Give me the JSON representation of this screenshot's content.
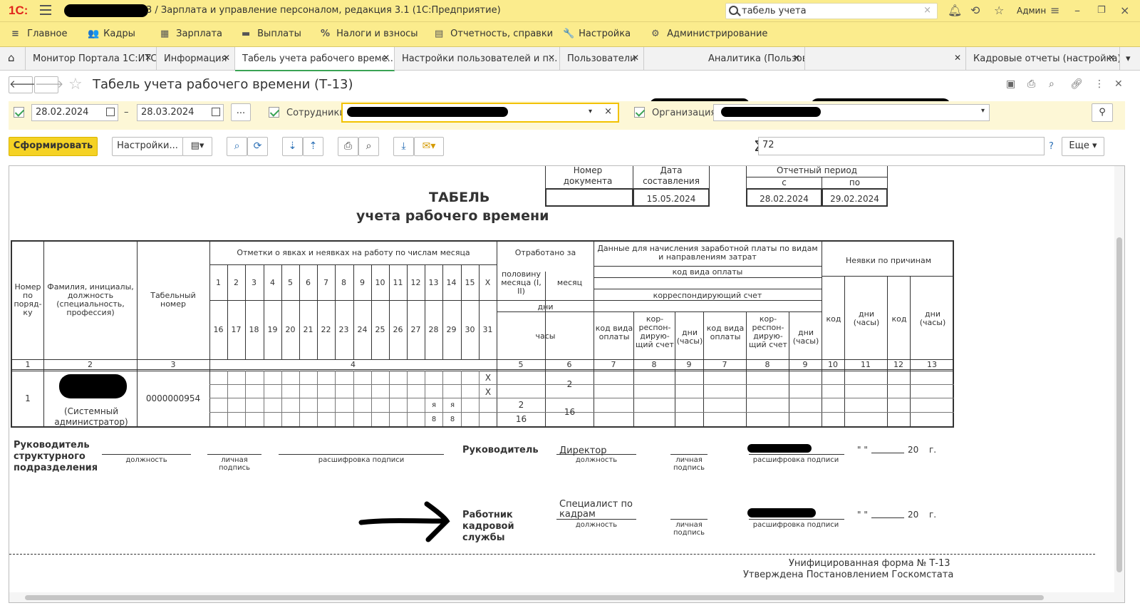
{
  "app": {
    "logo": "1С:",
    "title": "3 / Зарплата и управление персоналом, редакция 3.1  (1С:Предприятие)",
    "search_value": "табель учета",
    "user": "Админ"
  },
  "menu": [
    {
      "icon": "≡",
      "label": "Главное"
    },
    {
      "icon": "👥",
      "label": "Кадры"
    },
    {
      "icon": "▦",
      "label": "Зарплата"
    },
    {
      "icon": "▬",
      "label": "Выплаты"
    },
    {
      "icon": "%",
      "label": "Налоги и взносы"
    },
    {
      "icon": "▤",
      "label": "Отчетность, справки"
    },
    {
      "icon": "🔧",
      "label": "Настройка"
    },
    {
      "icon": "⚙",
      "label": "Администрирование"
    }
  ],
  "tabs": [
    {
      "label": "Монитор Портала 1С:ИТС"
    },
    {
      "label": "Информация"
    },
    {
      "label": "Табель учета рабочего време..."
    },
    {
      "label": "Настройки пользователей и п..."
    },
    {
      "label": "Пользователи"
    },
    {
      "label": "Аналитика (Пользова..."
    },
    {
      "label": ""
    },
    {
      "label": "Кадровые отчеты (настройка)"
    }
  ],
  "form": {
    "title": "Табель учета рабочего времени (Т-13)",
    "date_from": "28.02.2024",
    "date_sep": "–",
    "date_to": "28.03.2024",
    "dots": "...",
    "employees_label": "Сотрудники:",
    "org_label": "Организация:",
    "generate": "Сформировать",
    "settings": "Настройки...",
    "sum_value": "72",
    "help": "?",
    "more": "Еще"
  },
  "report": {
    "doc_num_header": "Номер документа",
    "doc_date_header": "Дата составления",
    "doc_date": "15.05.2024",
    "period_header": "Отчетный период",
    "period_from_label": "с",
    "period_to_label": "по",
    "period_from": "28.02.2024",
    "period_to": "29.02.2024",
    "title1": "ТАБЕЛЬ",
    "title2": "учета  рабочего времени",
    "h_num": "Номер по поряд-ку",
    "h_name": "Фамилия, инициалы, должность (специальность, профессия)",
    "h_tab": "Табельный номер",
    "h_marks": "Отметки о явках и неявках на работу по числам месяца",
    "h_worked": "Отработано за",
    "h_half": "половину месяца (I, II)",
    "h_month": "месяц",
    "h_days": "дни",
    "h_hours": "часы",
    "h_pay": "Данные для начисления заработной платы по видам и направлениям затрат",
    "h_paycode": "код вида оплаты",
    "h_corr": "корреспондирующий счет",
    "h_sub_code": "код вида оплаты",
    "h_sub_corr": "кор-респон-дирую-щий счет",
    "h_sub_days": "дни (часы)",
    "h_abs": "Неявки по причинам",
    "h_abs_code": "код",
    "h_abs_days": "дни (часы)",
    "days1": [
      "1",
      "2",
      "3",
      "4",
      "5",
      "6",
      "7",
      "8",
      "9",
      "10",
      "11",
      "12",
      "13",
      "14",
      "15",
      "X"
    ],
    "days2": [
      "16",
      "17",
      "18",
      "19",
      "20",
      "21",
      "22",
      "23",
      "24",
      "25",
      "26",
      "27",
      "28",
      "29",
      "30",
      "31"
    ],
    "colnums": [
      "1",
      "2",
      "3",
      "4",
      "5",
      "6",
      "7",
      "8",
      "9",
      "7",
      "8",
      "9",
      "10",
      "11",
      "12",
      "13"
    ],
    "row": {
      "num": "1",
      "position": "(Системный администратор)",
      "tab_num": "0000000954",
      "x1": "X",
      "x2": "X",
      "month_days": "2",
      "half_days": "2",
      "month_hours": "16",
      "half_hours": "16",
      "d28": "я",
      "d29": "я",
      "h28": "8",
      "h29": "8"
    },
    "sig": {
      "dept_head": "Руководитель структурного подразделения",
      "head": "Руководитель",
      "head_pos": "Директор",
      "hr": "Работник кадровой службы",
      "hr_pos": "Специалист по кадрам",
      "cap_pos": "должность",
      "cap_sig": "личная подпись",
      "cap_decode": "расшифровка подписи",
      "date_q": "\" \"",
      "year": "20",
      "g": "г."
    },
    "footer1": "Унифицированная форма № Т-13",
    "footer2": "Утверждена Постановлением Госкомстата"
  }
}
